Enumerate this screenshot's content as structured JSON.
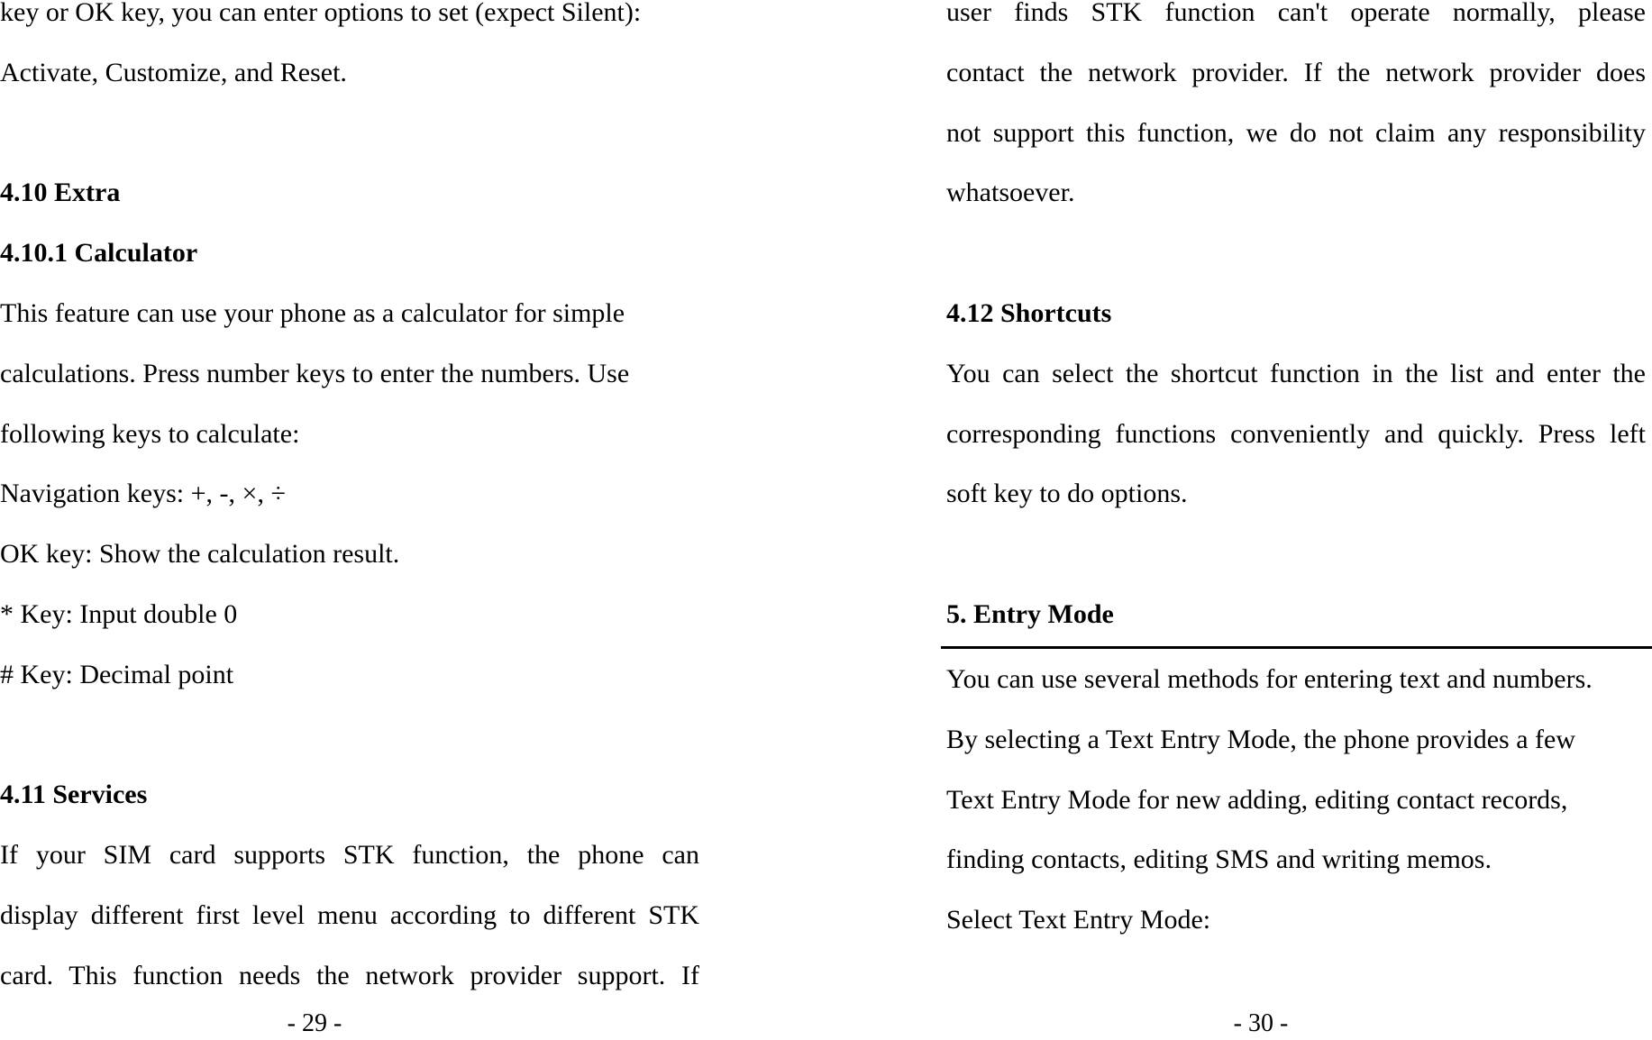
{
  "left_page": {
    "lines": [
      {
        "t": "key or OK key, you can enter options to set (expect Silent):"
      },
      {
        "t": "Activate, Customize, and Reset."
      },
      {
        "t": ""
      },
      {
        "t": "4.10 Extra",
        "b": true
      },
      {
        "t": "4.10.1 Calculator",
        "b": true
      },
      {
        "t": "This feature can use your phone as a calculator for simple"
      },
      {
        "t": "calculations. Press number keys to enter the numbers. Use"
      },
      {
        "t": "following keys to calculate:"
      },
      {
        "t": "Navigation keys: +, -, ×, ÷"
      },
      {
        "t": "OK key: Show the calculation result."
      },
      {
        "t": "* Key: Input double 0"
      },
      {
        "t": "# Key: Decimal point"
      },
      {
        "t": ""
      },
      {
        "t": "4.11 Services",
        "b": true
      },
      {
        "t": "If your SIM card supports STK function, the phone can",
        "j": true
      },
      {
        "t": "display different first level menu according to different STK",
        "j": true
      },
      {
        "t": "card. This function needs the network provider support. If",
        "j": true
      }
    ],
    "page_number": "- 29 -"
  },
  "right_page": {
    "lines": [
      {
        "t": "user finds STK function can't operate normally, please",
        "j": true
      },
      {
        "t": "contact the network provider. If the network provider does",
        "j": true
      },
      {
        "t": "not support this function, we do not claim any responsibility",
        "j": true
      },
      {
        "t": "whatsoever."
      },
      {
        "t": ""
      },
      {
        "t": "4.12 Shortcuts",
        "b": true
      },
      {
        "t": "You can select the shortcut function in the list and enter the",
        "j": true
      },
      {
        "t": "corresponding functions conveniently and quickly. Press left",
        "j": true
      },
      {
        "t": "soft key to do options."
      },
      {
        "t": ""
      },
      {
        "t": "5. Entry Mode",
        "b": true
      }
    ],
    "after_rule": [
      {
        "t": "You can use several methods for entering text and numbers."
      },
      {
        "t": "By selecting a Text Entry Mode, the phone provides a few"
      },
      {
        "t": "Text Entry Mode for new adding, editing contact records,"
      },
      {
        "t": "finding contacts, editing SMS and writing memos."
      },
      {
        "t": "Select Text Entry Mode:"
      }
    ],
    "page_number": "- 30 -"
  }
}
